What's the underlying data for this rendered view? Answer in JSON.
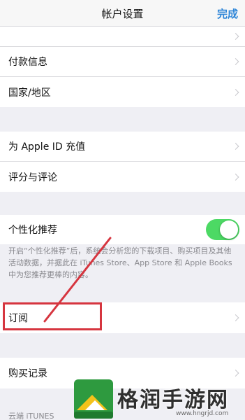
{
  "nav": {
    "title": "帐户设置",
    "done_label": "完成"
  },
  "groups": {
    "payment": {
      "label": "付款信息"
    },
    "region": {
      "label": "国家/地区"
    },
    "topup": {
      "label": "为 Apple ID 充值"
    },
    "ratings": {
      "label": "评分与评论"
    },
    "personalized": {
      "label": "个性化推荐",
      "toggle_on": true,
      "footnote": "开启“个性化推荐”后，系统会分析您的下载项目、购买项目及其他活动数据，并据此在 iTunes Store、App Store 和 Apple Books 中为您推荐更棒的内容。"
    },
    "subscriptions": {
      "label": "订阅"
    },
    "purchase_history": {
      "label": "购买记录"
    },
    "cloud_header": "云端 iTUNES"
  },
  "watermark": {
    "text": "格润手游网",
    "url": "www.hngrjd.com"
  },
  "colors": {
    "accent": "#2f86d8",
    "toggle": "#4cd964",
    "highlight": "#d6353f"
  }
}
